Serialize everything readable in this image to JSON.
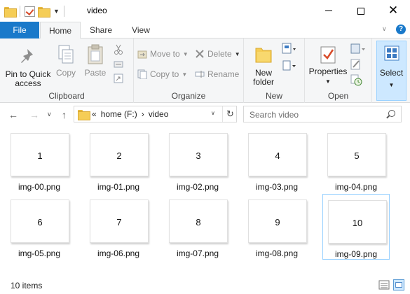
{
  "window": {
    "title": "video"
  },
  "tabs": {
    "file": "File",
    "home": "Home",
    "share": "Share",
    "view": "View",
    "help": "?"
  },
  "ribbon": {
    "clipboard": {
      "label": "Clipboard",
      "pin": "Pin to Quick access",
      "copy": "Copy",
      "paste": "Paste"
    },
    "organize": {
      "label": "Organize",
      "move_to": "Move to",
      "copy_to": "Copy to",
      "delete": "Delete",
      "rename": "Rename"
    },
    "new": {
      "label": "New",
      "new_folder": "New folder"
    },
    "open": {
      "label": "Open",
      "properties": "Properties"
    },
    "select": {
      "select": "Select"
    }
  },
  "address": {
    "overflow": "«",
    "crumbs": [
      "home (F:)",
      "video"
    ],
    "separator": "›"
  },
  "search": {
    "placeholder": "Search video"
  },
  "files": [
    {
      "thumb": "1",
      "name": "img-00.png"
    },
    {
      "thumb": "2",
      "name": "img-01.png"
    },
    {
      "thumb": "3",
      "name": "img-02.png"
    },
    {
      "thumb": "4",
      "name": "img-03.png"
    },
    {
      "thumb": "5",
      "name": "img-04.png"
    },
    {
      "thumb": "6",
      "name": "img-05.png"
    },
    {
      "thumb": "7",
      "name": "img-06.png"
    },
    {
      "thumb": "8",
      "name": "img-07.png"
    },
    {
      "thumb": "9",
      "name": "img-08.png"
    },
    {
      "thumb": "10",
      "name": "img-09.png",
      "selected": true
    }
  ],
  "status": {
    "count": "10 items"
  },
  "colors": {
    "accent": "#1979ca",
    "ribbon_bg": "#f5f6f7",
    "selection_border": "#99d1ff"
  }
}
